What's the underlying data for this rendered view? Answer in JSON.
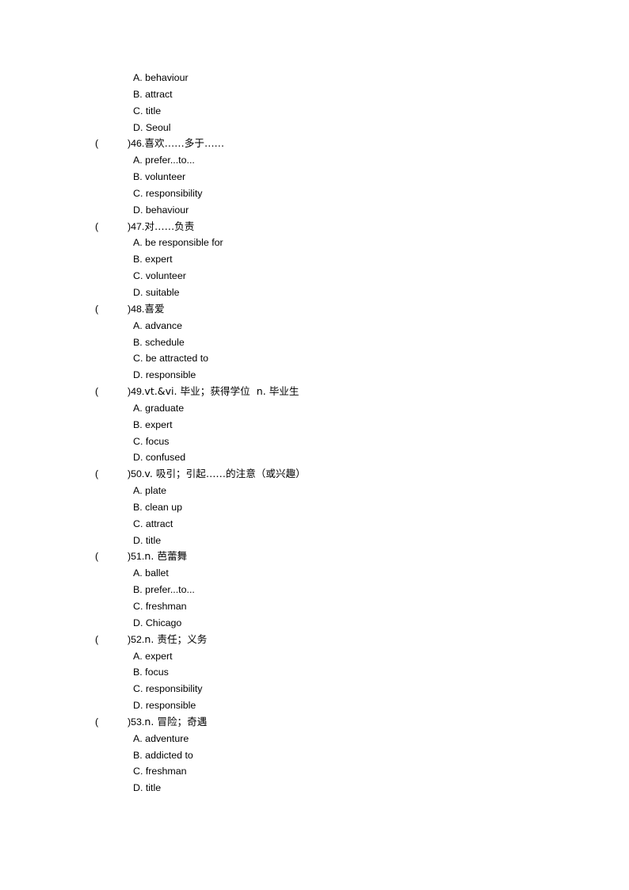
{
  "document": {
    "type": "vocabulary-multiple-choice-worksheet",
    "orphan_options": [
      {
        "letter": "A.",
        "text": "behaviour"
      },
      {
        "letter": "B.",
        "text": "attract"
      },
      {
        "letter": "C.",
        "text": "title"
      },
      {
        "letter": "D.",
        "text": "Seoul"
      }
    ],
    "questions": [
      {
        "bracket_open": "(",
        "bracket_close": ")",
        "number": "46.",
        "prompt": "喜欢……多于……",
        "options": [
          {
            "letter": "A.",
            "text": "prefer...to..."
          },
          {
            "letter": "B.",
            "text": "volunteer"
          },
          {
            "letter": "C.",
            "text": "responsibility"
          },
          {
            "letter": "D.",
            "text": "behaviour"
          }
        ]
      },
      {
        "bracket_open": "(",
        "bracket_close": ")",
        "number": "47.",
        "prompt": "对……负责",
        "options": [
          {
            "letter": "A.",
            "text": "be responsible for"
          },
          {
            "letter": "B.",
            "text": "expert"
          },
          {
            "letter": "C.",
            "text": "volunteer"
          },
          {
            "letter": "D.",
            "text": "suitable"
          }
        ]
      },
      {
        "bracket_open": "(",
        "bracket_close": ")",
        "number": "48.",
        "prompt": "喜爱",
        "options": [
          {
            "letter": "A.",
            "text": "advance"
          },
          {
            "letter": "B.",
            "text": "schedule"
          },
          {
            "letter": "C.",
            "text": "be attracted to"
          },
          {
            "letter": "D.",
            "text": "responsible"
          }
        ]
      },
      {
        "bracket_open": "(",
        "bracket_close": ")",
        "number": "49.",
        "prompt": "vt.&vi. 毕业；获得学位  n. 毕业生",
        "options": [
          {
            "letter": "A.",
            "text": "graduate"
          },
          {
            "letter": "B.",
            "text": "expert"
          },
          {
            "letter": "C.",
            "text": "focus"
          },
          {
            "letter": "D.",
            "text": "confused"
          }
        ]
      },
      {
        "bracket_open": "(",
        "bracket_close": ")",
        "number": "50.",
        "prompt": "v. 吸引；引起……的注意（或兴趣）",
        "options": [
          {
            "letter": "A.",
            "text": "plate"
          },
          {
            "letter": "B.",
            "text": "clean up"
          },
          {
            "letter": "C.",
            "text": "attract"
          },
          {
            "letter": "D.",
            "text": "title"
          }
        ]
      },
      {
        "bracket_open": "(",
        "bracket_close": ")",
        "number": "51.",
        "prompt": "n. 芭蕾舞",
        "options": [
          {
            "letter": "A.",
            "text": "ballet"
          },
          {
            "letter": "B.",
            "text": "prefer...to..."
          },
          {
            "letter": "C.",
            "text": "freshman"
          },
          {
            "letter": "D.",
            "text": "Chicago"
          }
        ]
      },
      {
        "bracket_open": "(",
        "bracket_close": ")",
        "number": "52.",
        "prompt": "n. 责任；义务",
        "options": [
          {
            "letter": "A.",
            "text": "expert"
          },
          {
            "letter": "B.",
            "text": "focus"
          },
          {
            "letter": "C.",
            "text": "responsibility"
          },
          {
            "letter": "D.",
            "text": "responsible"
          }
        ]
      },
      {
        "bracket_open": "(",
        "bracket_close": ")",
        "number": "53.",
        "prompt": "n. 冒险；奇遇",
        "options": [
          {
            "letter": "A.",
            "text": "adventure"
          },
          {
            "letter": "B.",
            "text": "addicted to"
          },
          {
            "letter": "C.",
            "text": "freshman"
          },
          {
            "letter": "D.",
            "text": "title"
          }
        ]
      }
    ]
  }
}
